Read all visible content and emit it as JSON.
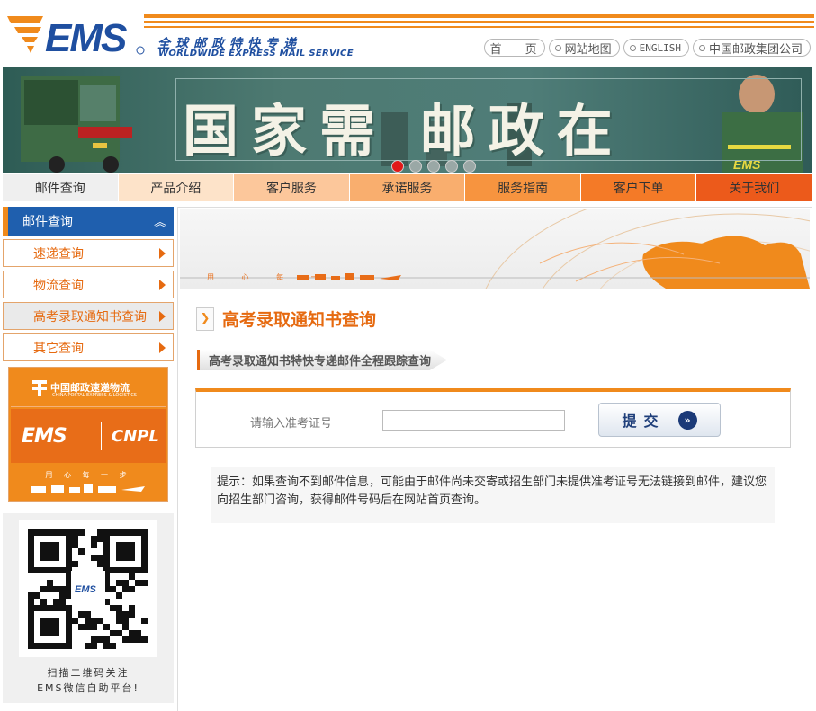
{
  "header": {
    "slogan_cn": "全球邮政特快专递",
    "slogan_en": "WORLDWIDE EXPRESS MAIL SERVICE",
    "top_links": [
      "首　　页",
      "网站地图",
      "ENGLISH",
      "中国邮政集团公司"
    ]
  },
  "banner": {
    "headline": "国家需 邮政在",
    "slide_count": 5,
    "active_slide": 1
  },
  "nav": {
    "items": [
      {
        "label": "邮件查询",
        "bg": "#efefef"
      },
      {
        "label": "产品介绍",
        "bg": "#fde3c9"
      },
      {
        "label": "客户服务",
        "bg": "#fcc79b"
      },
      {
        "label": "承诺服务",
        "bg": "#f9ae6e"
      },
      {
        "label": "服务指南",
        "bg": "#f7943f"
      },
      {
        "label": "客户下单",
        "bg": "#f47a27"
      },
      {
        "label": "关于我们",
        "bg": "#ec5a1b"
      }
    ]
  },
  "sidebar": {
    "header": "邮件查询",
    "items": [
      {
        "label": "速递查询",
        "active": false
      },
      {
        "label": "物流查询",
        "active": false
      },
      {
        "label": "高考录取通知书查询",
        "active": true
      },
      {
        "label": "其它查询",
        "active": false
      }
    ],
    "promo": {
      "cpel_cn": "中国邮政速递物流",
      "cpel_en": "CHINA POSTAL EXPRESS & LOGISTICS",
      "ems": "EMS",
      "cnpl": "CNPL",
      "motto": "用 心 每 一 步"
    },
    "qr": {
      "caption_line1": "扫描二维码关注",
      "caption_line2": "EMS微信自助平台!"
    }
  },
  "main": {
    "page_title": "高考录取通知书查询",
    "sub_tab": "高考录取通知书特快专递邮件全程跟踪查询",
    "banner_motto": "用 心 每 一 步",
    "form": {
      "label": "请输入准考证号",
      "input_value": "",
      "input_placeholder": "",
      "submit_label": "提交",
      "submit_icon": "»"
    },
    "notice": "提示：如果查询不到邮件信息，可能由于邮件尚未交寄或招生部门未提供准考证号无法链接到邮件，建议您向招生部门咨询，获得邮件号码后在网站首页查询。"
  },
  "colors": {
    "brand_orange": "#f08a1c",
    "brand_blue": "#1f5fae",
    "title_orange": "#e66a10"
  }
}
